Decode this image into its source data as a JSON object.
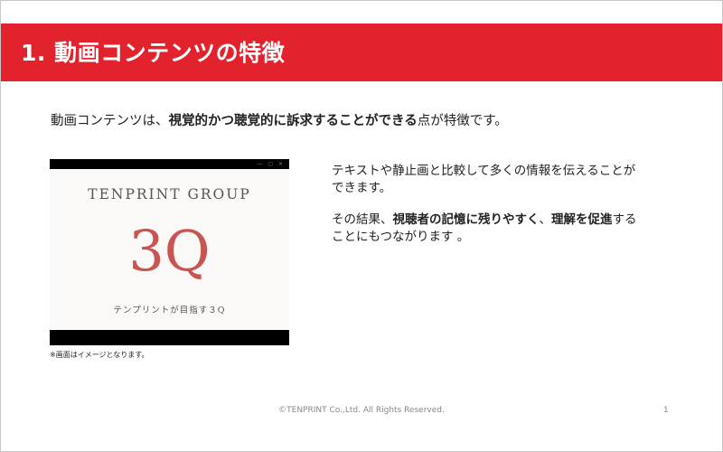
{
  "slide": {
    "title": "1. 動画コンテンツの特徴",
    "lead": {
      "part1": "動画コンテンツは、",
      "part2": "視覚的かつ聴覚的に訴求することができる",
      "part3": "点が特徴です。"
    },
    "video": {
      "group_text": "TENPRINT GROUP",
      "big_text": "3Q",
      "caption": "テンプリントが目指す３Q",
      "controls": "― ▢ ✕"
    },
    "note": "※画面はイメージとなります。",
    "paragraph1": {
      "line1": "テキストや静止画と比較して多くの情報を伝えることが",
      "line2": "できます。"
    },
    "paragraph2": {
      "part1": "その結果、",
      "part2": "視聴者の記憶に残りやすく",
      "part3": "、",
      "part4": "理解を促進",
      "part5": "する",
      "line2": "ことにもつながります 。"
    },
    "footer": "©TENPRINT Co.,Ltd. All Rights Reserved.",
    "page_number": "1"
  },
  "colors": {
    "accent": "#e2232e",
    "logo_red": "#c95552"
  }
}
